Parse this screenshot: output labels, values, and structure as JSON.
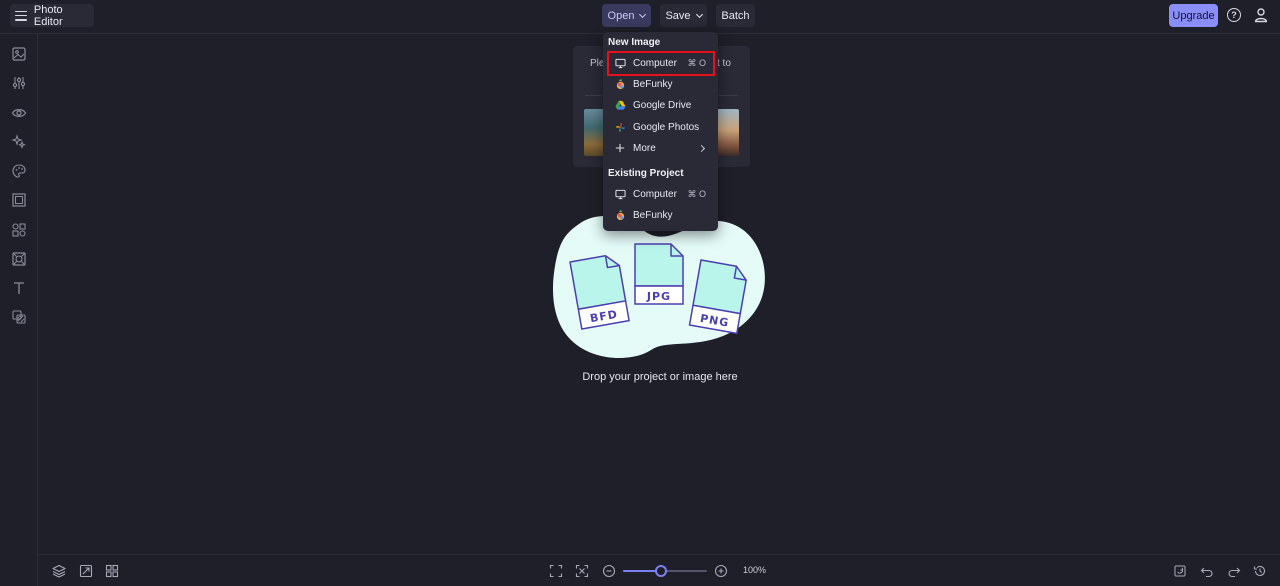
{
  "app": {
    "title": "Photo Editor"
  },
  "topbar": {
    "open_label": "Open",
    "save_label": "Save",
    "batch_label": "Batch",
    "upgrade_label": "Upgrade",
    "help_glyph": "?"
  },
  "start_panel": {
    "text_left": "Ple",
    "text_right": "t to"
  },
  "open_menu": {
    "new_image_header": "New Image",
    "new_image_items": [
      {
        "label": "Computer",
        "icon": "monitor-icon",
        "shortcut": "⌘ O"
      },
      {
        "label": "BeFunky",
        "icon": "befunky-icon"
      },
      {
        "label": "Google Drive",
        "icon": "google-drive-icon"
      },
      {
        "label": "Google Photos",
        "icon": "google-photos-icon"
      },
      {
        "label": "More",
        "icon": "plus-icon",
        "has_submenu": true
      }
    ],
    "existing_project_header": "Existing Project",
    "existing_project_items": [
      {
        "label": "Computer",
        "icon": "monitor-icon",
        "shortcut": "⌘ O"
      },
      {
        "label": "BeFunky",
        "icon": "befunky-icon"
      }
    ]
  },
  "drop_zone": {
    "file_types": [
      "BFD",
      "JPG",
      "PNG"
    ],
    "text": "Drop your project or image here"
  },
  "zoom": {
    "level": 0.45,
    "label": "100%"
  },
  "colors": {
    "accent": "#8a8ef8",
    "highlight": "#e8101c",
    "blob": "#e4fbf8",
    "file_fill": "#b9f5ea",
    "file_stroke": "#4a3fb0"
  }
}
